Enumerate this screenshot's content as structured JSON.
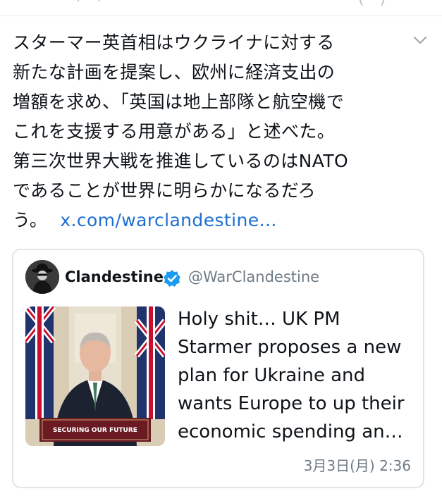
{
  "post": {
    "text_lines": [
      "スターマー英首相はウクライナに対する",
      "新たな計画を提案し、欧州に経済支出の",
      "増額を求め、「英国は地上部隊と航空機で",
      "これを支援する用意がある」と述べた。",
      "第三次世界大戦を推進しているのはNATO",
      "であることが世界に明らかになるだろ",
      "う。"
    ],
    "link_text": "x.com/warclandestine…"
  },
  "quote": {
    "author_name": "Clandestine",
    "handle": "@WarClandestine",
    "text_lines": [
      "Holy shit… UK PM",
      "Starmer proposes a new",
      "plan for Ukraine and",
      "wants Europe to up their",
      "economic spending an…"
    ],
    "image_sign_text": "SECURING OUR FUTURE",
    "timestamp": "3月3日(月) 2:36"
  },
  "colors": {
    "link": "#1d6fd0",
    "verified": "#1d9bf0",
    "muted": "#6e7b86",
    "border": "#dfe5ea"
  }
}
